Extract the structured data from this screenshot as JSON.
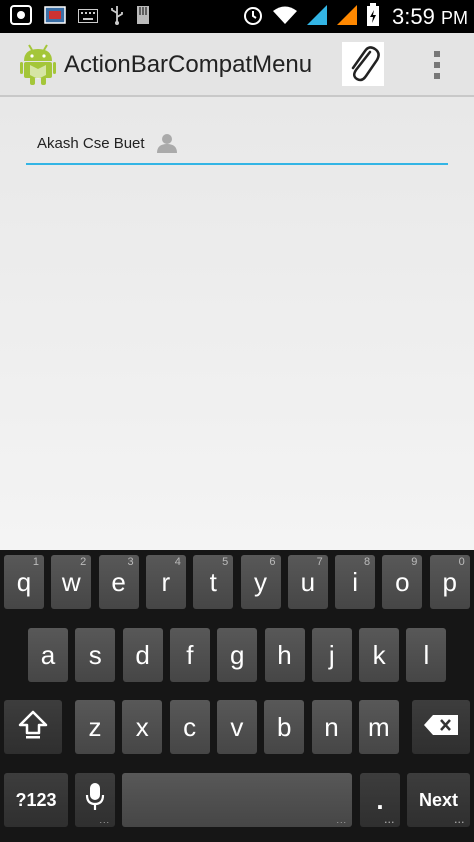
{
  "status_bar": {
    "time": "3:59",
    "time_suffix": "PM",
    "icons": [
      "screenshot-icon",
      "gallery-icon",
      "keyboard-icon",
      "usb-icon",
      "sd-card-icon",
      "alarm-icon",
      "wifi-icon",
      "signal-blue-icon",
      "signal-orange-icon",
      "battery-icon"
    ]
  },
  "action_bar": {
    "title": "ActionBarCompatMenu",
    "app_icon": "android-icon",
    "attach_icon": "paperclip-icon",
    "overflow_icon": "overflow-menu-icon"
  },
  "field": {
    "chip_text": "Akash Cse Buet",
    "chip_icon": "person-icon",
    "underline_color": "#33b5e5"
  },
  "keyboard": {
    "row1": [
      {
        "label": "q",
        "hint": "1"
      },
      {
        "label": "w",
        "hint": "2"
      },
      {
        "label": "e",
        "hint": "3"
      },
      {
        "label": "r",
        "hint": "4"
      },
      {
        "label": "t",
        "hint": "5"
      },
      {
        "label": "y",
        "hint": "6"
      },
      {
        "label": "u",
        "hint": "7"
      },
      {
        "label": "i",
        "hint": "8"
      },
      {
        "label": "o",
        "hint": "9"
      },
      {
        "label": "p",
        "hint": "0"
      }
    ],
    "row2": [
      "a",
      "s",
      "d",
      "f",
      "g",
      "h",
      "j",
      "k",
      "l"
    ],
    "row3": [
      "z",
      "x",
      "c",
      "v",
      "b",
      "n",
      "m"
    ],
    "shift_icon": "shift-icon",
    "backspace_icon": "backspace-icon",
    "symbols_label": "?123",
    "mic_icon": "microphone-icon",
    "period_label": ".",
    "next_label": "Next"
  }
}
